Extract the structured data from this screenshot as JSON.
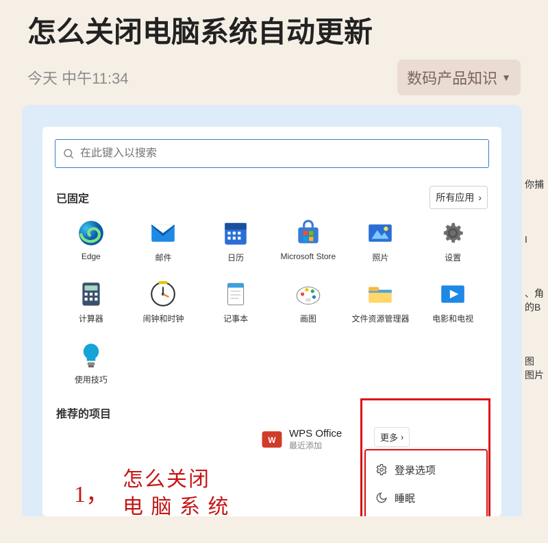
{
  "article": {
    "title": "怎么关闭电脑系统自动更新",
    "timestamp": "今天 中午11:34",
    "category": "数码产品知识"
  },
  "startmenu": {
    "search_placeholder": "在此键入以搜索",
    "pinned_title": "已固定",
    "all_apps_label": "所有应用",
    "more_label": "更多",
    "apps": [
      {
        "id": "edge",
        "label": "Edge"
      },
      {
        "id": "mail",
        "label": "邮件"
      },
      {
        "id": "calendar",
        "label": "日历"
      },
      {
        "id": "store",
        "label": "Microsoft Store"
      },
      {
        "id": "photos",
        "label": "照片"
      },
      {
        "id": "settings",
        "label": "设置"
      },
      {
        "id": "calc",
        "label": "计算器"
      },
      {
        "id": "clock",
        "label": "闹钟和时钟"
      },
      {
        "id": "notepad",
        "label": "记事本"
      },
      {
        "id": "paint",
        "label": "画图"
      },
      {
        "id": "explorer",
        "label": "文件资源管理器"
      },
      {
        "id": "movies",
        "label": "电影和电视"
      },
      {
        "id": "tips",
        "label": "使用技巧"
      }
    ],
    "recommended_title": "推荐的项目",
    "recommended": {
      "wps": {
        "name": "WPS Office",
        "sub": "最近添加"
      }
    },
    "power_menu": {
      "signin_options": "登录选项",
      "sleep": "睡眠"
    }
  },
  "annotation": {
    "number": "1，",
    "line1": "怎么关闭",
    "line2": "电 脑 系 统"
  },
  "side_fragments": {
    "a": "你捕",
    "b": "I",
    "c": "、角\n的B",
    "d": "图\n图片"
  }
}
